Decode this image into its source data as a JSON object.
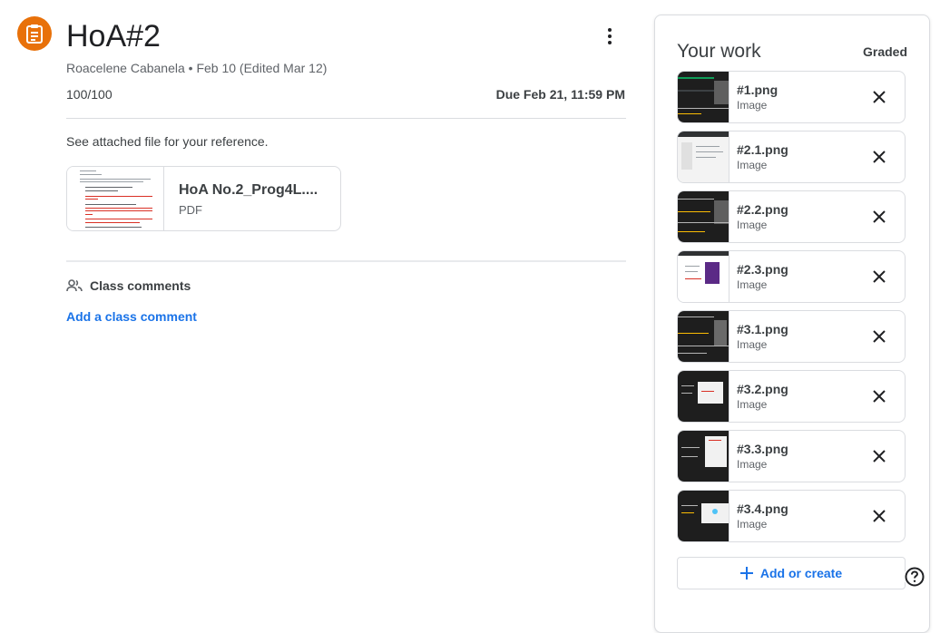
{
  "assignment": {
    "icon": "assignment-icon",
    "title": "HoA#2",
    "author": "Roacelene Cabanela",
    "separator": "•",
    "date": "Feb 10 (Edited Mar 12)",
    "points": "100/100",
    "due": "Due Feb 21, 11:59 PM",
    "description": "See attached file for your reference.",
    "attachment": {
      "title": "HoA No.2_Prog4L....",
      "type": "PDF"
    },
    "accent_color": "#e8710a"
  },
  "comments": {
    "icon": "people-icon",
    "label": "Class comments",
    "add_label": "Add a class comment"
  },
  "your_work": {
    "title": "Your work",
    "status": "Graded",
    "files": [
      {
        "name": "#1.png",
        "type": "Image"
      },
      {
        "name": "#2.1.png",
        "type": "Image"
      },
      {
        "name": "#2.2.png",
        "type": "Image"
      },
      {
        "name": "#2.3.png",
        "type": "Image"
      },
      {
        "name": "#3.1.png",
        "type": "Image"
      },
      {
        "name": "#3.2.png",
        "type": "Image"
      },
      {
        "name": "#3.3.png",
        "type": "Image"
      },
      {
        "name": "#3.4.png",
        "type": "Image"
      }
    ],
    "add_label": "Add or create",
    "link_color": "#1a73e8"
  }
}
